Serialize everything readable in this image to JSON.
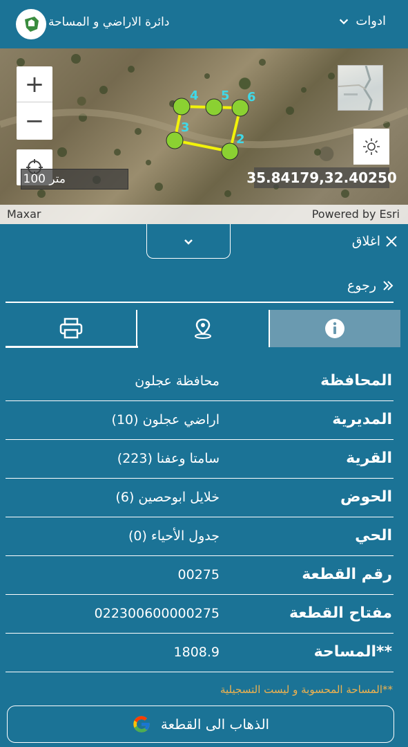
{
  "header": {
    "department_title": "دائرة الاراضي و المساحة",
    "tools_label": "ادوات"
  },
  "map": {
    "zoom_in_label": "+",
    "zoom_out_label": "−",
    "scale_label": "100 متر",
    "coordinates": "35.84179,32.40250",
    "attribution_left": "Maxar",
    "attribution_right": "Powered by Esri",
    "parcel_vertices": [
      "2",
      "3",
      "4",
      "5",
      "6"
    ],
    "parcel_colors": {
      "line": "#f2f20a",
      "vertex": "#8bd132",
      "label": "#3fd9e8"
    }
  },
  "panel": {
    "close_label": "اغلاق",
    "back_label": "رجوع",
    "tabs": [
      {
        "name": "info",
        "icon": "info-icon"
      },
      {
        "name": "location",
        "icon": "location-pin-icon"
      },
      {
        "name": "print",
        "icon": "printer-icon"
      }
    ],
    "rows": [
      {
        "label": "المحافظة",
        "value": "محافظة عجلون"
      },
      {
        "label": "المديرية",
        "value": "اراضي عجلون (10)"
      },
      {
        "label": "القرية",
        "value": "سامتا وعفنا (223)"
      },
      {
        "label": "الحوض",
        "value": "خلايل ابوحصين (6)"
      },
      {
        "label": "الحي",
        "value": "جدول الأحياء (0)"
      },
      {
        "label": "رقم القطعة",
        "value": "00275"
      },
      {
        "label": "مفتاح القطعة",
        "value": "022300600000275"
      },
      {
        "label": "**المساحة",
        "value": "1808.9"
      }
    ],
    "note": "**المساحة المحسوبة و ليست التسجيلية",
    "goto_button_label": "الذهاب الى القطعة",
    "accent_note_color": "#f0b24e",
    "background_color": "#1b7396"
  }
}
